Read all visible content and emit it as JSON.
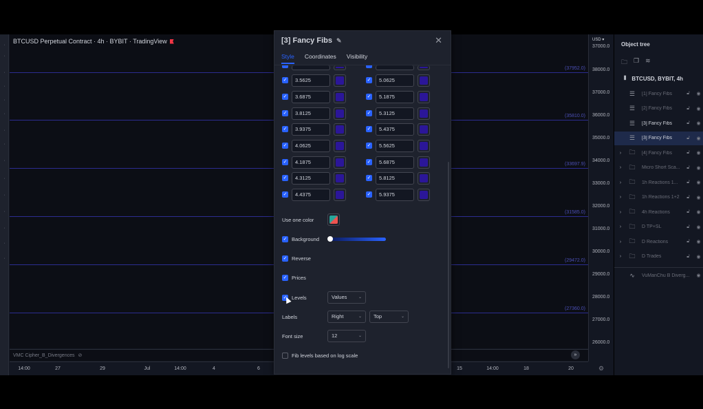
{
  "chart": {
    "symbol_title": "BTCUSD Perpetual Contract · 4h · BYBIT · TradingView",
    "level_tags": [
      "(37952.0)",
      "(35810.0)",
      "(33697.9)",
      "(31585.0)",
      "(29472.0)",
      "(27360.0)"
    ],
    "indicator_label": "VMC Cipher_B_Divergences",
    "time_ticks": [
      "14:00",
      "27",
      "29",
      "Jul",
      "14:00",
      "4",
      "6",
      "15",
      "14:00",
      "18",
      "20"
    ],
    "price_ticks": [
      "37000.0",
      "38000.0",
      "37000.0",
      "36000.0",
      "35000.0",
      "34000.0",
      "33000.0",
      "32000.0",
      "31000.0",
      "30000.0",
      "29000.0",
      "28000.0",
      "27000.0",
      "26000.0"
    ],
    "currency": "USD ▾"
  },
  "object_tree": {
    "header": "Object tree",
    "symbol": "BTCUSD, BYBIT, 4h",
    "items": [
      {
        "label": "[1] Fancy Fibs",
        "icon": "fib-icon",
        "folder": false
      },
      {
        "label": "[2] Fancy Fibs",
        "icon": "fib-icon",
        "folder": false
      },
      {
        "label": "[3] Fancy Fibs",
        "icon": "fib-icon",
        "folder": false
      },
      {
        "label": "[3] Fancy Fibs",
        "icon": "fib-icon",
        "folder": false
      },
      {
        "label": "[4] Fancy Fibs",
        "icon": "folder-icon",
        "folder": true
      },
      {
        "label": "Micro Short Sca...",
        "icon": "folder-icon",
        "folder": true
      },
      {
        "label": "1h Reactions 1...",
        "icon": "folder-icon",
        "folder": true
      },
      {
        "label": "1h Reactions 1+2",
        "icon": "folder-icon",
        "folder": true
      },
      {
        "label": "4h Reactions",
        "icon": "folder-icon",
        "folder": true
      },
      {
        "label": "D TP+SL",
        "icon": "folder-icon",
        "folder": true
      },
      {
        "label": "D Reactions",
        "icon": "folder-icon",
        "folder": true
      },
      {
        "label": "D Trades",
        "icon": "folder-icon",
        "folder": true
      }
    ],
    "indicator": "VuManChu B Diverg..."
  },
  "dialog": {
    "title": "[3] Fancy Fibs",
    "tabs": [
      "Style",
      "Coordinates",
      "Visibility"
    ],
    "level_color": "#2b1699",
    "levels_left": [
      "3.5625",
      "3.6875",
      "3.8125",
      "3.9375",
      "4.0625",
      "4.1875",
      "4.3125",
      "4.4375"
    ],
    "levels_right": [
      "5.0625",
      "5.1875",
      "5.3125",
      "5.4375",
      "5.5625",
      "5.6875",
      "5.8125",
      "5.9375"
    ],
    "use_one_color": "Use one color",
    "background": "Background",
    "reverse": "Reverse",
    "prices": "Prices",
    "levels": "Levels",
    "levels_value": "Values",
    "labels": "Labels",
    "labels_h": "Right",
    "labels_v": "Top",
    "font_size": "Font size",
    "font_size_value": "12",
    "log_scale": "Fib levels based on log scale"
  }
}
